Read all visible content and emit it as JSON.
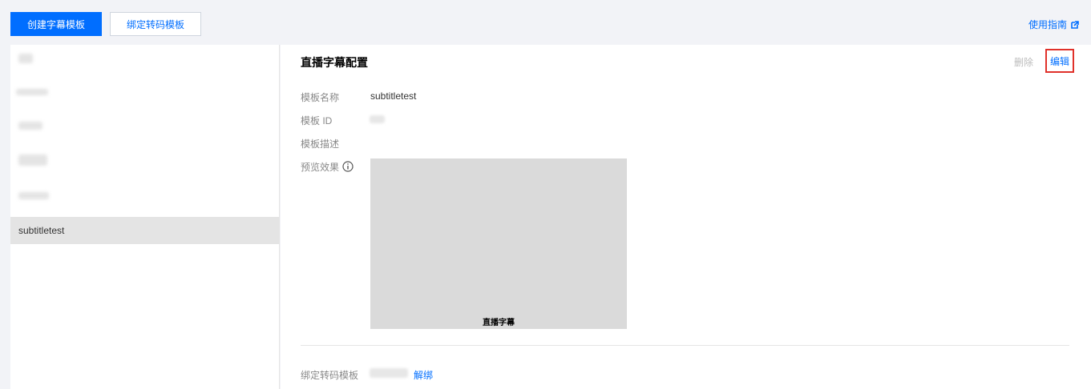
{
  "toolbar": {
    "create_label": "创建字幕模板",
    "bind_label": "绑定转码模板",
    "guide_label": "使用指南"
  },
  "sidebar": {
    "items": [
      {
        "label": "",
        "blurred": true
      },
      {
        "label": "",
        "blurred": true
      },
      {
        "label": "",
        "blurred": true
      },
      {
        "label": "",
        "blurred": true
      },
      {
        "label": "",
        "blurred": true
      },
      {
        "label": "subtitletest",
        "blurred": false,
        "selected": true
      }
    ]
  },
  "detail": {
    "title": "直播字幕配置",
    "delete_label": "删除",
    "edit_label": "编辑",
    "name_label": "模板名称",
    "name_value": "subtitletest",
    "id_label": "模板 ID",
    "desc_label": "模板描述",
    "preview_label": "预览效果",
    "preview_caption": "直播字幕",
    "bind_label": "绑定转码模板",
    "unbind_label": "解绑"
  },
  "colors": {
    "primary": "#006eff",
    "highlight_border": "#e0312a",
    "preview_bg": "#dadada"
  },
  "icons": {
    "external_link": "external-link-icon",
    "info": "info-icon"
  }
}
